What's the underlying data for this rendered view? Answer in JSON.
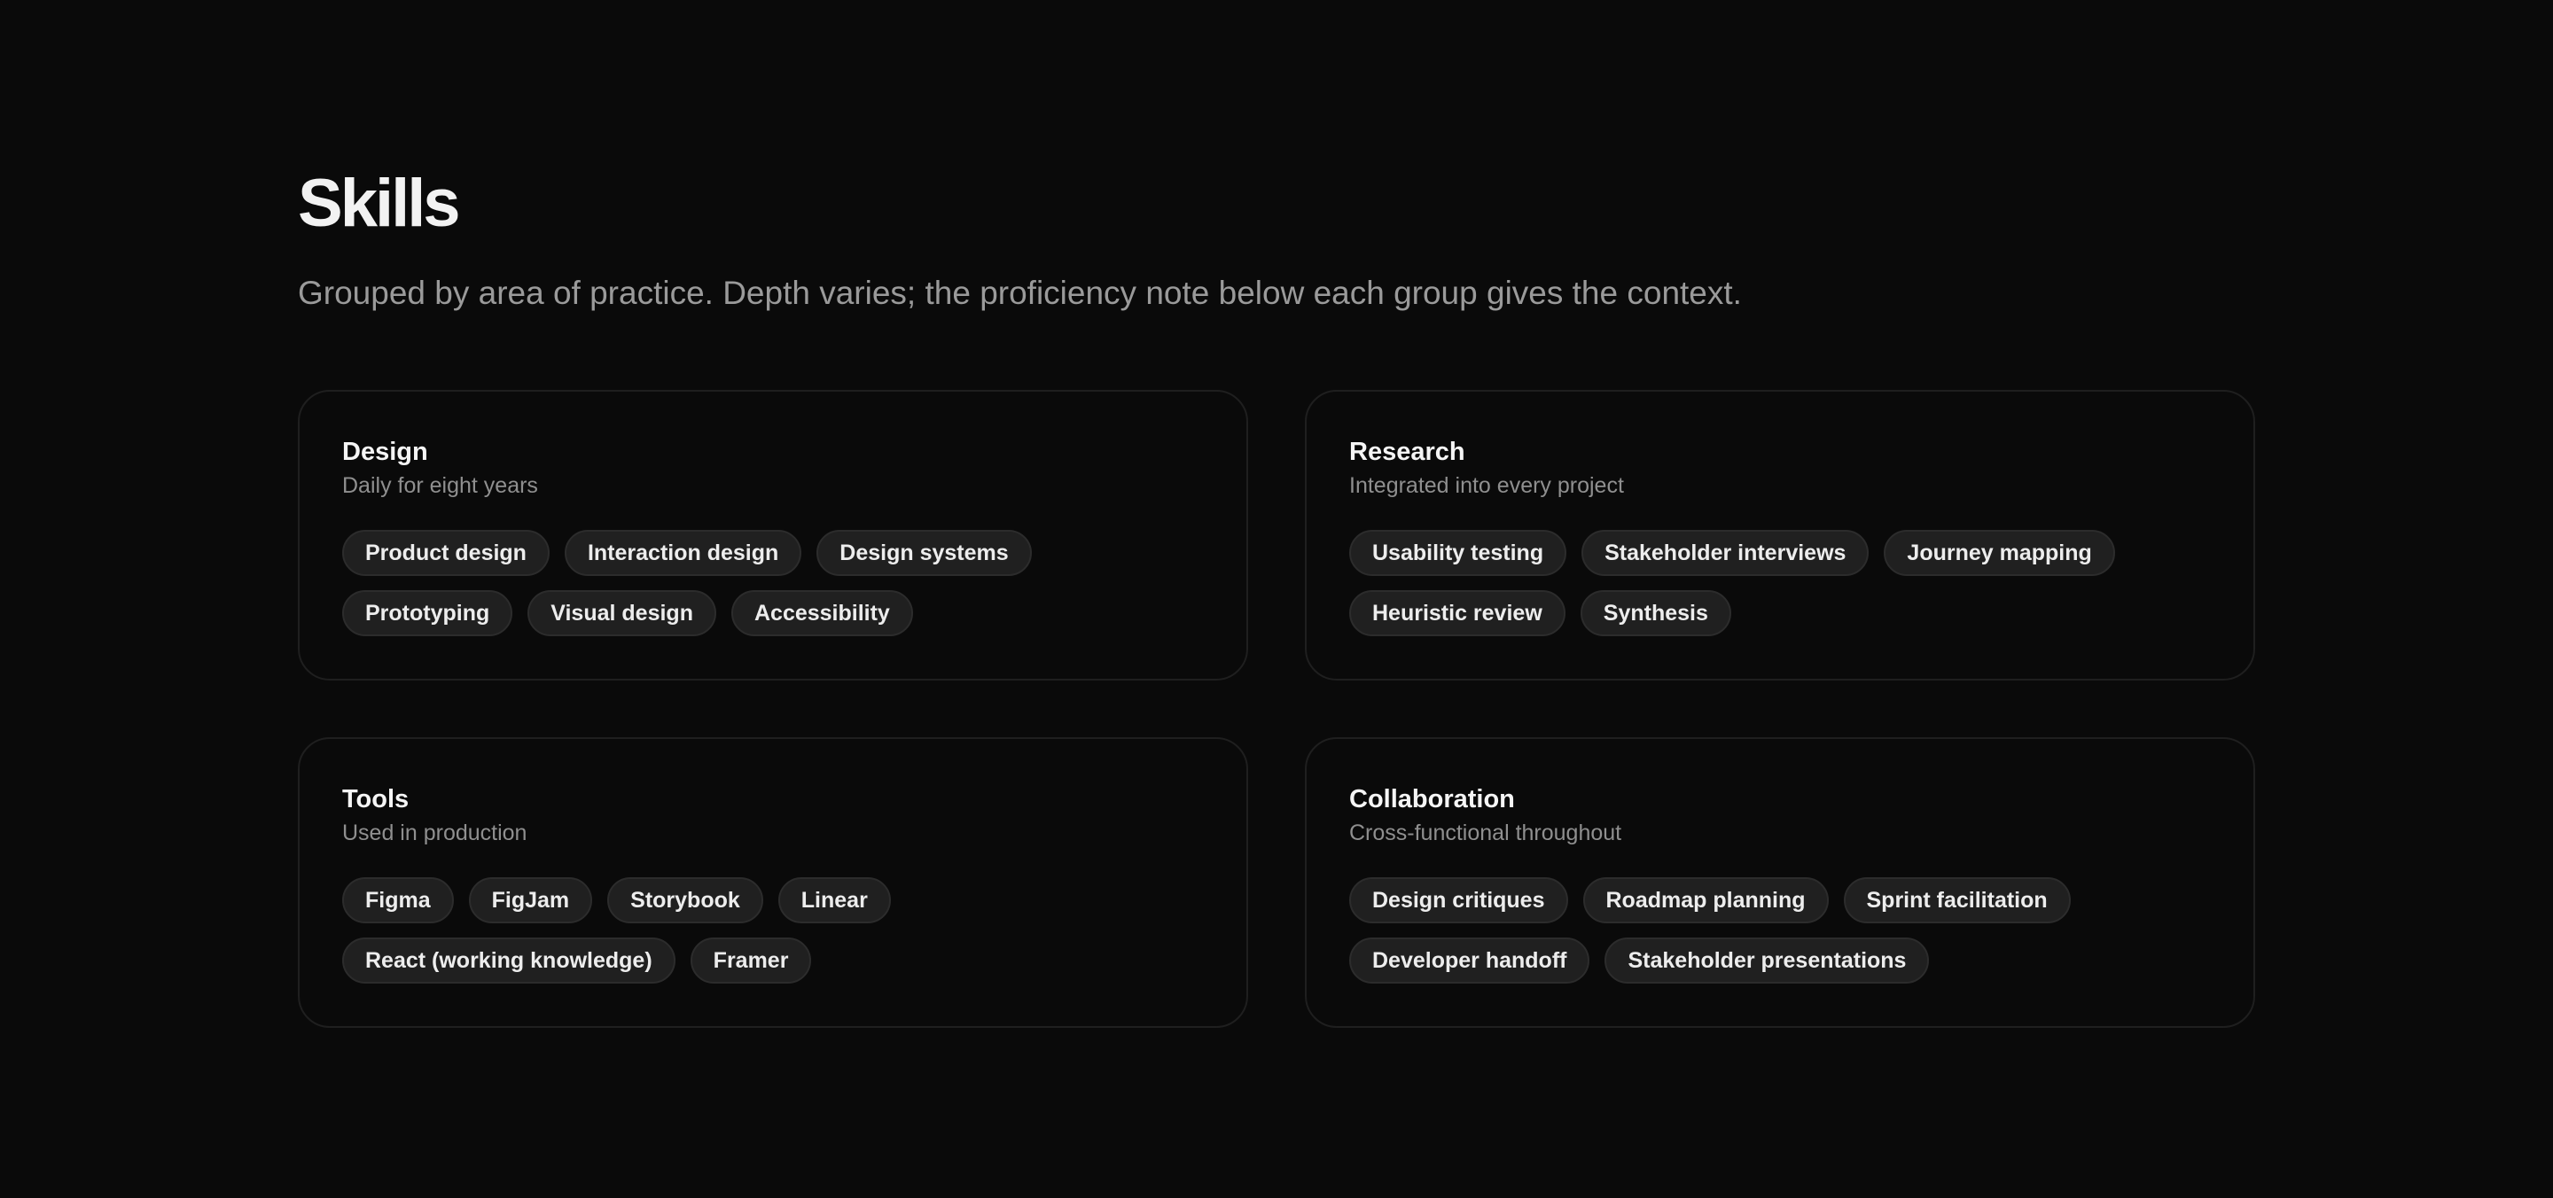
{
  "header": {
    "title": "Skills",
    "subtitle": "Grouped by area of practice. Depth varies; the proficiency note below each group gives the context."
  },
  "groups": [
    {
      "title": "Design",
      "note": "Daily for eight years",
      "tags": [
        "Product design",
        "Interaction design",
        "Design systems",
        "Prototyping",
        "Visual design",
        "Accessibility"
      ]
    },
    {
      "title": "Research",
      "note": "Integrated into every project",
      "tags": [
        "Usability testing",
        "Stakeholder interviews",
        "Journey mapping",
        "Heuristic review",
        "Synthesis"
      ]
    },
    {
      "title": "Tools",
      "note": "Used in production",
      "tags": [
        "Figma",
        "FigJam",
        "Storybook",
        "Linear",
        "React (working knowledge)",
        "Framer"
      ]
    },
    {
      "title": "Collaboration",
      "note": "Cross-functional throughout",
      "tags": [
        "Design critiques",
        "Roadmap planning",
        "Sprint facilitation",
        "Developer handoff",
        "Stakeholder presentations"
      ]
    }
  ],
  "colors": {
    "background": "#0a0a0a",
    "card_border": "#1f1f1f",
    "tag_background": "#202020",
    "tag_border": "#2c2c2c",
    "heading": "#f2f2f2",
    "muted": "#9a9a9a"
  }
}
